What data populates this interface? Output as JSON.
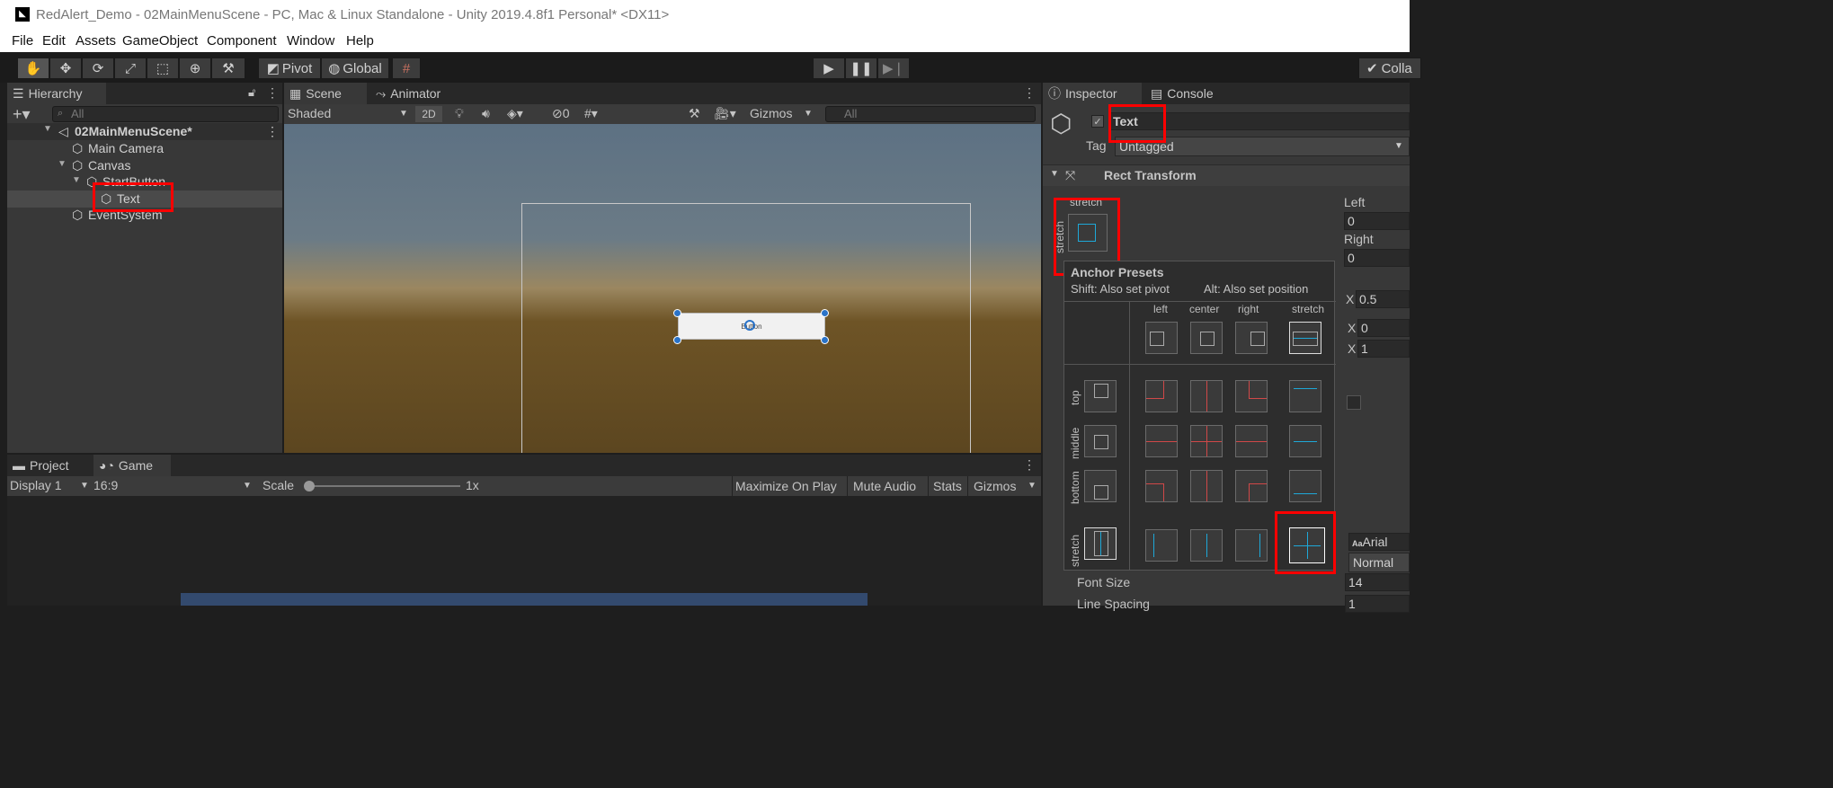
{
  "window": {
    "title": "RedAlert_Demo - 02MainMenuScene - PC, Mac & Linux Standalone - Unity 2019.4.8f1 Personal* <DX11>"
  },
  "menu": [
    "File",
    "Edit",
    "Assets",
    "GameObject",
    "Component",
    "Window",
    "Help"
  ],
  "toolbar": {
    "pivot": "Pivot",
    "global": "Global",
    "collab": "Colla"
  },
  "hierarchy": {
    "tab": "Hierarchy",
    "search_placeholder": "All",
    "scene": "02MainMenuScene*",
    "items": [
      "Main Camera",
      "Canvas",
      "StartButton",
      "Text",
      "EventSystem"
    ]
  },
  "scene_view": {
    "tabs": [
      "Scene",
      "Animator"
    ],
    "shading": "Shaded",
    "mode_2d": "2D",
    "hidden_count": "0",
    "gizmos": "Gizmos",
    "search_placeholder": "All",
    "button_text": "Button"
  },
  "bottom": {
    "tabs": [
      "Project",
      "Game"
    ],
    "display": "Display 1",
    "aspect": "16:9",
    "scale_label": "Scale",
    "scale_value": "1x",
    "scale_level": 0,
    "buttons": [
      "Maximize On Play",
      "Mute Audio",
      "Stats",
      "Gizmos"
    ]
  },
  "inspector": {
    "tabs": [
      "Inspector",
      "Console"
    ],
    "object_name": "Text",
    "tag_label": "Tag",
    "tag_value": "Untagged",
    "component": "Rect Transform",
    "stretch_top": "stretch",
    "stretch_side": "stretch",
    "left_label": "Left",
    "left_value": "0",
    "right_label": "Right",
    "right_value": "0",
    "x1_label": "X",
    "x1_value": "0.5",
    "x2_label": "X",
    "x2_value": "0",
    "x3_label": "X",
    "x3_value": "1",
    "font_name": "Arial",
    "font_style": "Normal",
    "font_size_label": "Font Size",
    "font_size_value": "14",
    "line_spacing_label": "Line Spacing",
    "line_spacing_value": "1"
  },
  "anchor_presets": {
    "title": "Anchor Presets",
    "shift_hint": "Shift: Also set pivot",
    "alt_hint": "Alt: Also set position",
    "columns": [
      "left",
      "center",
      "right",
      "stretch"
    ],
    "rows": [
      "top",
      "middle",
      "bottom",
      "stretch"
    ]
  },
  "colors": {
    "accent": "#1ea8d8",
    "anchor_red": "#d04848",
    "anchor_yellow": "#e0a020",
    "highlight": "#ff0000"
  }
}
